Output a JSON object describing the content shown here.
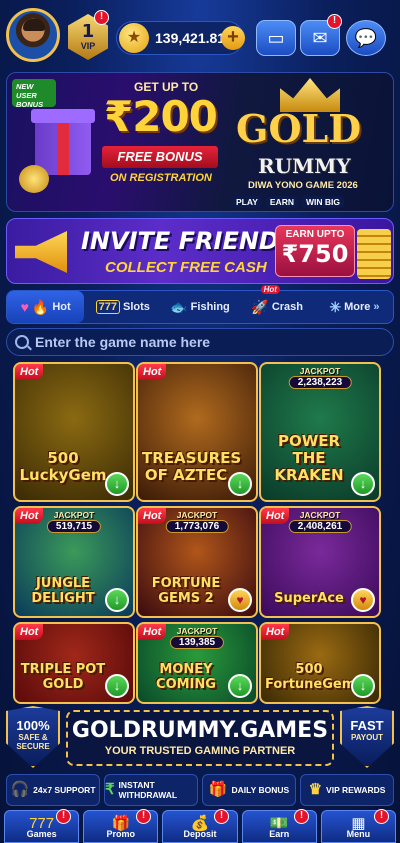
{
  "top": {
    "vip_level": "1",
    "vip_label": "VIP",
    "vip_badge": "!",
    "balance": "139,421.81",
    "plus": "+",
    "mail_badge": "!"
  },
  "banner1": {
    "tag": "NEW USER BONUS",
    "get": "GET UP TO",
    "amount": "₹200",
    "free": "FREE BONUS",
    "reg": "ON REGISTRATION",
    "gold": "GOLD",
    "rummy": "RUMMY",
    "game": "DIWA YONO GAME 2026",
    "tags": [
      "PLAY",
      "EARN",
      "WIN BIG"
    ]
  },
  "banner2": {
    "title": "INVITE FRIENDS",
    "sub": "COLLECT FREE CASH",
    "earn_label": "EARN UPTO",
    "earn_value": "₹750"
  },
  "categories": [
    {
      "label": "Hot",
      "icon": "heart-flame-icon"
    },
    {
      "label": "Slots",
      "icon": "slots-777-icon"
    },
    {
      "label": "Fishing",
      "icon": "fish-icon"
    },
    {
      "label": "Crash",
      "icon": "rocket-icon",
      "badge": "Hot"
    },
    {
      "label": "More",
      "icon": "compass-icon"
    }
  ],
  "search": {
    "placeholder": "Enter the game name here"
  },
  "hot_label": "Hot",
  "jackpot_label": "JACKPOT",
  "games": [
    {
      "title": "500 LuckyGem",
      "hot": true,
      "jackpot": "",
      "action": "download",
      "colors": [
        "#3a2a05",
        "#8a6a12"
      ]
    },
    {
      "title": "TREASURES OF AZTEC",
      "hot": true,
      "jackpot": "",
      "action": "download",
      "colors": [
        "#3a1a08",
        "#b06a1e"
      ]
    },
    {
      "title": "POWER THE KRAKEN",
      "hot": false,
      "jackpot": "2,238,223",
      "action": "download",
      "colors": [
        "#0a3a2a",
        "#1f7a4a"
      ]
    },
    {
      "title": "JUNGLE DELIGHT",
      "hot": true,
      "jackpot": "519,715",
      "action": "download",
      "colors": [
        "#0a3a5a",
        "#3b9a5a"
      ]
    },
    {
      "title": "FORTUNE GEMS 2",
      "hot": true,
      "jackpot": "1,773,076",
      "action": "favorite",
      "colors": [
        "#3a0a10",
        "#b0561a"
      ]
    },
    {
      "title": "SuperAce",
      "hot": true,
      "jackpot": "2,408,261",
      "action": "favorite",
      "colors": [
        "#3a0a5a",
        "#7a2a9a"
      ]
    },
    {
      "title": "TRIPLE POT GOLD",
      "hot": true,
      "jackpot": "",
      "action": "download",
      "colors": [
        "#5a0a0a",
        "#a0281a"
      ]
    },
    {
      "title": "MONEY COMING",
      "hot": true,
      "jackpot": "139,385",
      "action": "download",
      "colors": [
        "#0a4a2a",
        "#2a9a3a"
      ]
    },
    {
      "title": "500 FortuneGem",
      "hot": true,
      "jackpot": "",
      "action": "download",
      "colors": [
        "#3a2a05",
        "#9a6a12"
      ]
    }
  ],
  "brand": {
    "left_a": "100%",
    "left_b": "SAFE & SECURE",
    "domain": "GOLDRUMMY.GAMES",
    "slogan": "YOUR TRUSTED GAMING PARTNER",
    "right_a": "FAST",
    "right_b": "PAYOUT"
  },
  "features": [
    {
      "label": "24x7 SUPPORT",
      "icon": "headset-icon"
    },
    {
      "label": "INSTANT WITHDRAWAL",
      "icon": "wallet-icon"
    },
    {
      "label": "DAILY BONUS",
      "icon": "gift-icon"
    },
    {
      "label": "VIP REWARDS",
      "icon": "crown-icon"
    }
  ],
  "nav": [
    {
      "label": "Games",
      "icon": "slots-icon"
    },
    {
      "label": "Promo",
      "icon": "gift-icon"
    },
    {
      "label": "Deposit",
      "icon": "deposit-icon"
    },
    {
      "label": "Earn",
      "icon": "earn-icon"
    },
    {
      "label": "Menu",
      "icon": "menu-icon"
    }
  ]
}
